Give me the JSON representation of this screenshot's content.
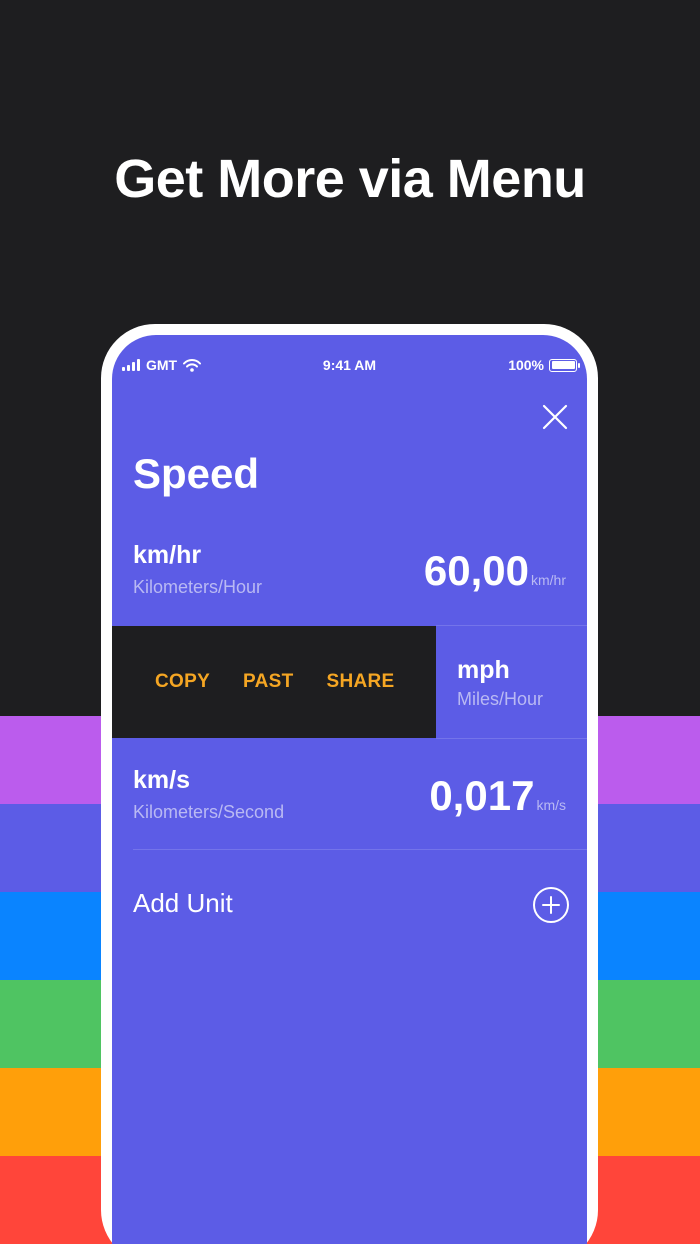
{
  "headline": "Get More via Menu",
  "colors": {
    "background": "#1e1e20",
    "screen": "#5c5ce6",
    "menu_text": "#f5a623",
    "stripes": [
      "#bb5ced",
      "#5c5ce6",
      "#0a84ff",
      "#4fc462",
      "#ff9f0a",
      "#ff453a"
    ]
  },
  "status_bar": {
    "carrier": "GMT",
    "time": "9:41 AM",
    "battery": "100%"
  },
  "screen": {
    "title": "Speed",
    "units": [
      {
        "abbr": "km/hr",
        "full": "Kilometers/Hour",
        "value": "60,00",
        "suffix": "km/hr"
      },
      {
        "abbr": "mph",
        "full": "Miles/Hour"
      },
      {
        "abbr": "km/s",
        "full": "Kilometers/Second",
        "value": "0,017",
        "suffix": "km/s"
      }
    ],
    "context_menu": {
      "copy": "COPY",
      "paste": "PAST",
      "share": "SHARE"
    },
    "add_unit": "Add Unit"
  }
}
